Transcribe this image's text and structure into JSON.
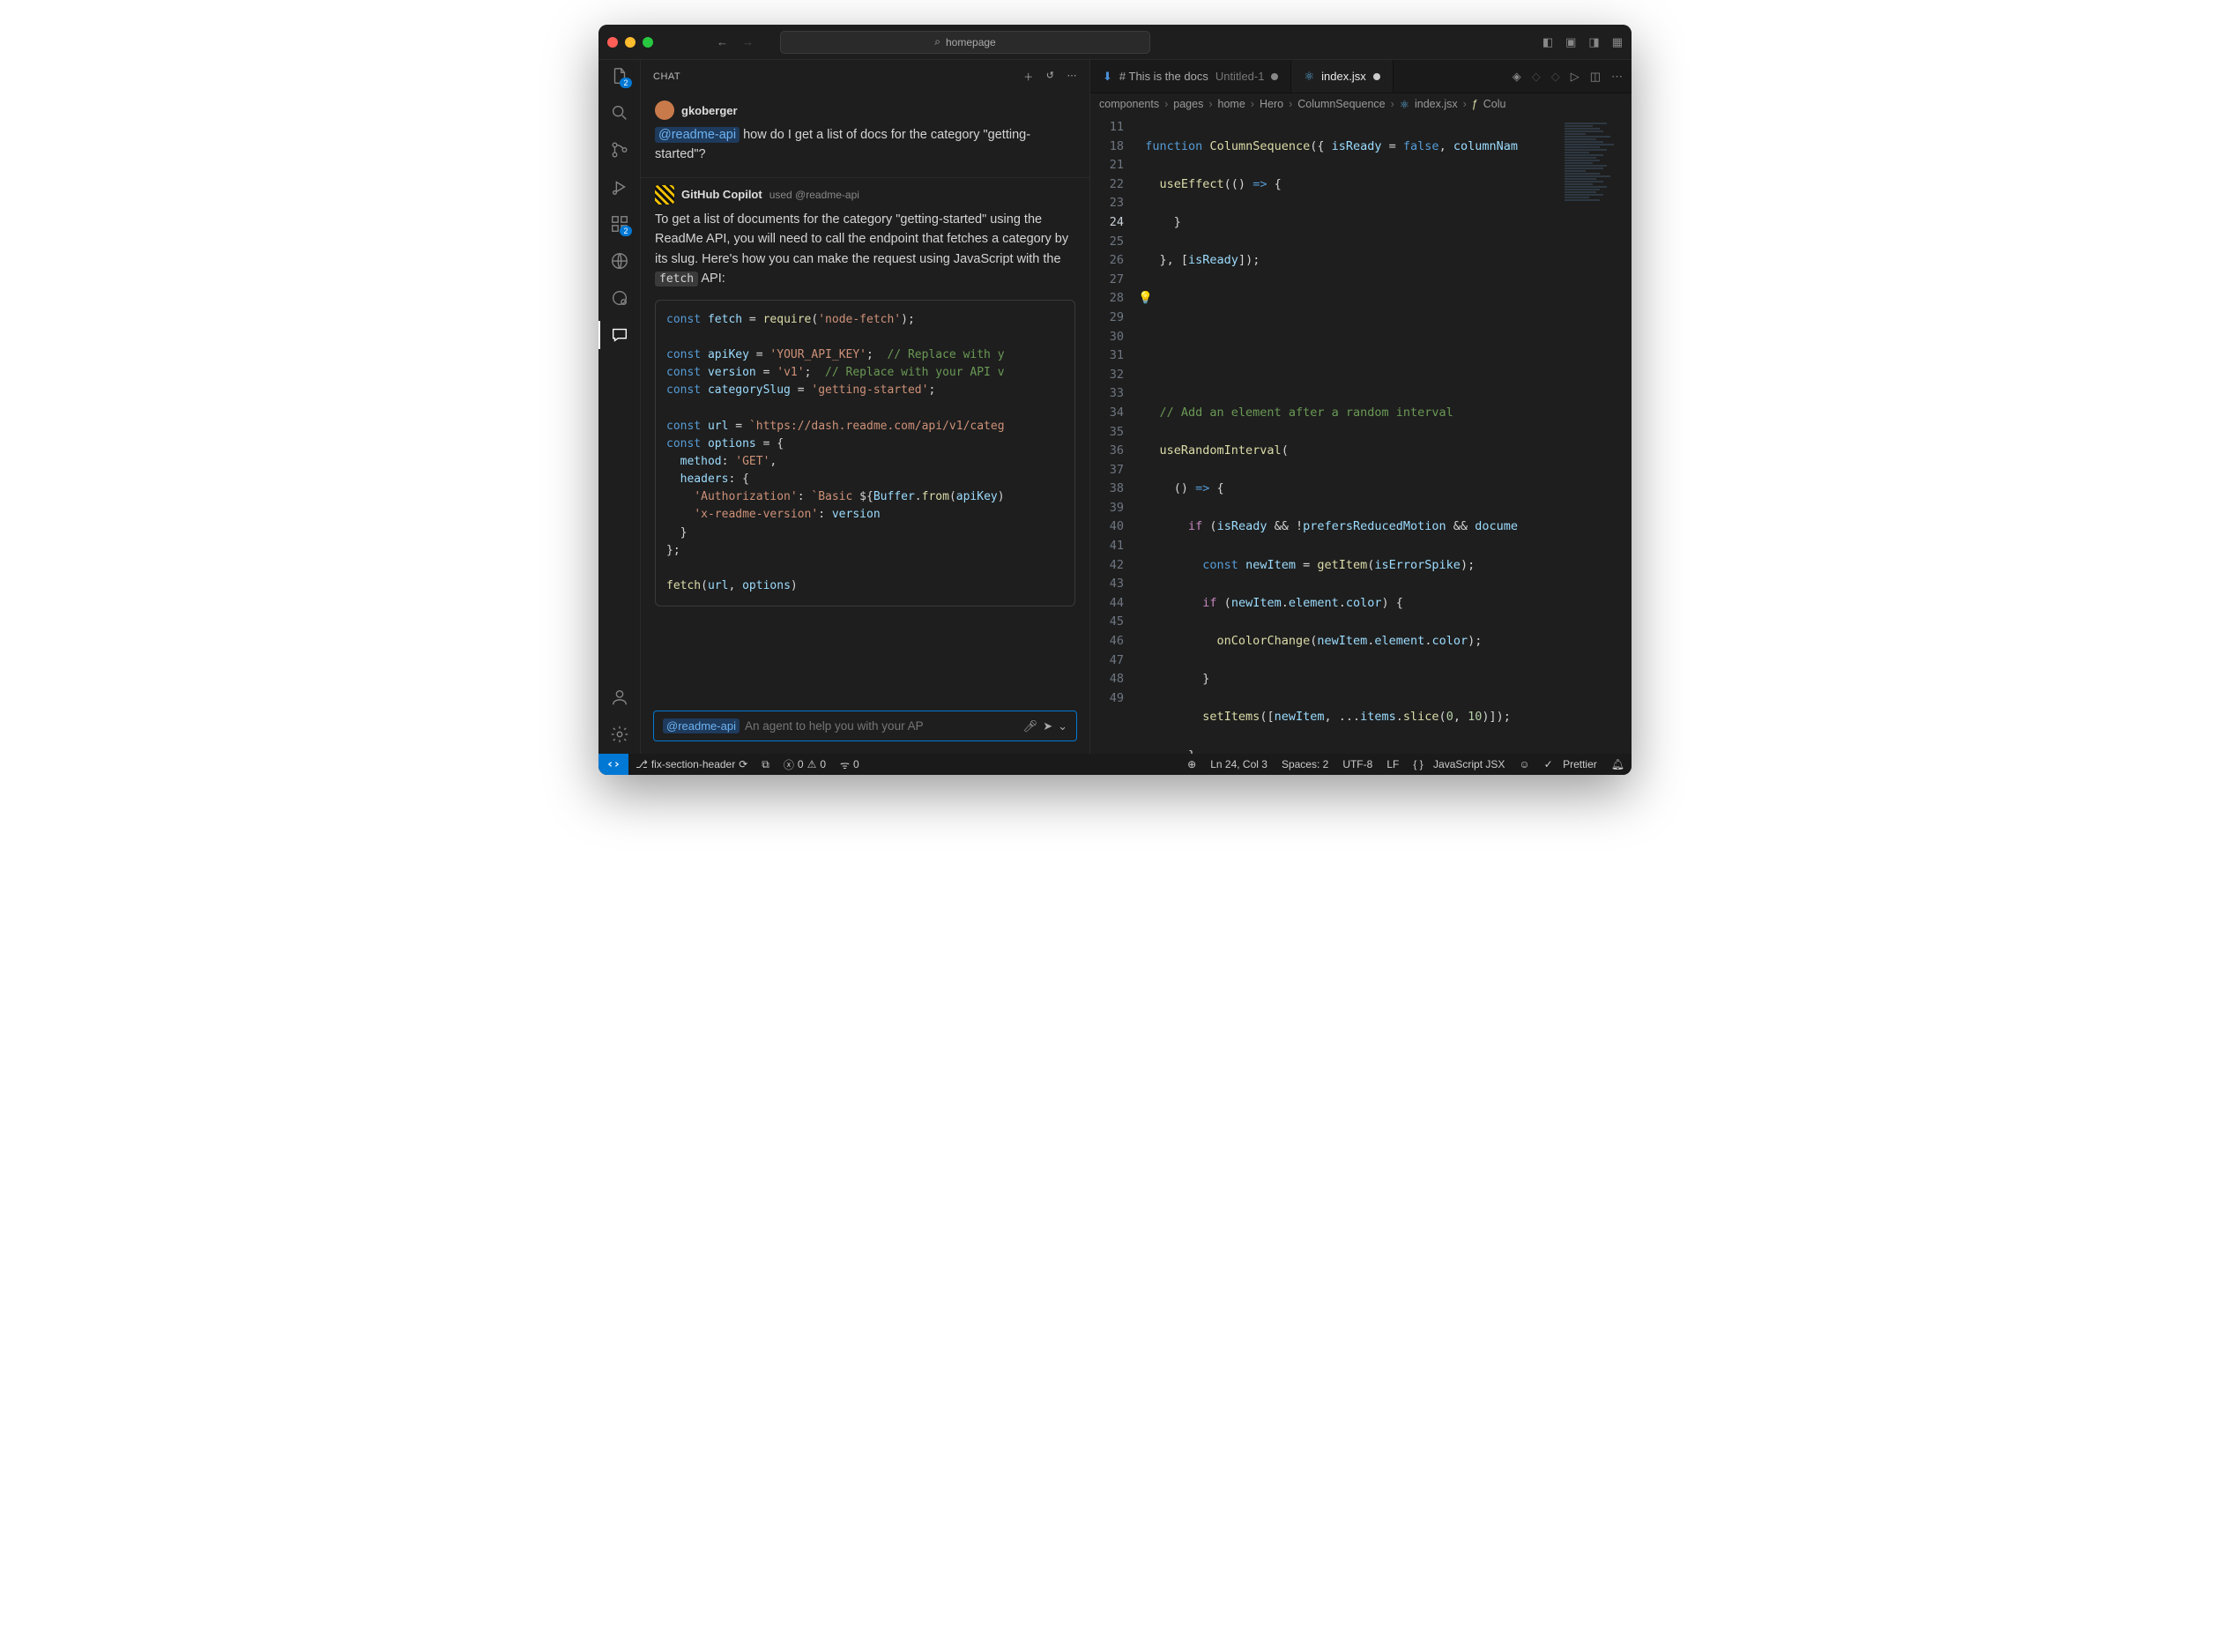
{
  "search_placeholder": "homepage",
  "activity_badges": {
    "explorer": "2",
    "extensions": "2"
  },
  "chat": {
    "title": "CHAT",
    "user": {
      "name": "gkoberger",
      "msg_prefix": "@readme-api",
      "msg_rest": " how do I get a list of docs for the category \"getting-started\"?"
    },
    "bot": {
      "name": "GitHub Copilot",
      "used_label": "used @readme-api",
      "msg": "To get a list of documents for the category \"getting-started\" using the ReadMe API, you will need to call the endpoint that fetches a category by its slug. Here's how you can make the request using JavaScript with the ",
      "msg_code": "fetch",
      "msg_tail": " API:"
    },
    "input_prefix": "@readme-api",
    "input_placeholder": "An agent to help you with your AP"
  },
  "tabs": [
    {
      "icon": "arrow-down-icon",
      "label": "# This is the docs",
      "suffix": "Untitled-1",
      "modified": true,
      "active": false,
      "color": "#4a90d9"
    },
    {
      "icon": "react-icon",
      "label": "index.jsx",
      "modified": true,
      "active": true,
      "color": "#5aa7d8"
    }
  ],
  "breadcrumb": [
    "components",
    "pages",
    "home",
    "Hero",
    "ColumnSequence",
    "index.jsx",
    "Colu"
  ],
  "code_lines": [
    11,
    18,
    21,
    22,
    23,
    24,
    25,
    26,
    27,
    28,
    29,
    30,
    31,
    32,
    33,
    34,
    35,
    36,
    37,
    38,
    39,
    40,
    41,
    42,
    43,
    44,
    45,
    46,
    47,
    48,
    49
  ],
  "code_current_line": 24,
  "statusbar": {
    "branch": "fix-section-header",
    "errors": "0",
    "warnings": "0",
    "ports": "0",
    "cursor": "Ln 24, Col 3",
    "spaces": "Spaces: 2",
    "encoding": "UTF-8",
    "eol": "LF",
    "lang": "JavaScript JSX",
    "copilot": "",
    "prettier": "Prettier"
  }
}
